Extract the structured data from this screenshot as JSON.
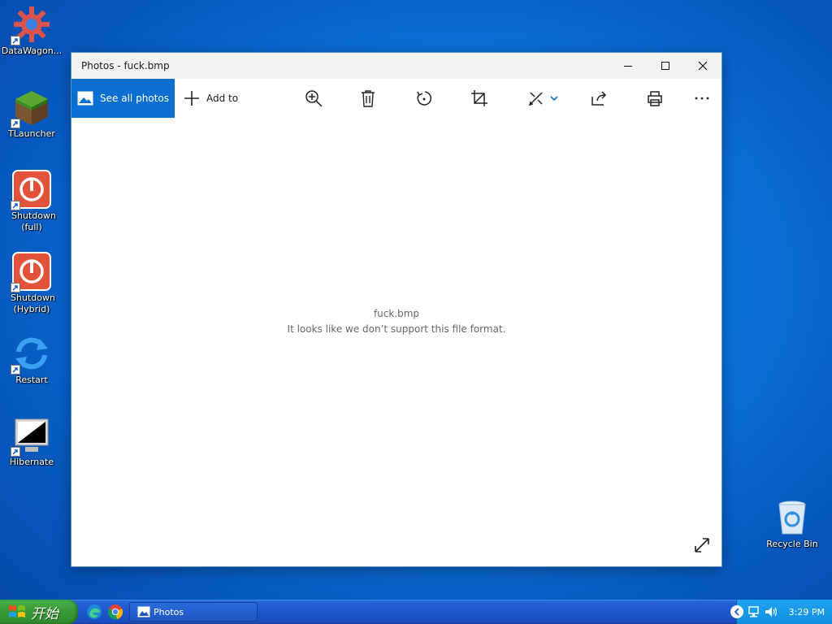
{
  "desktop": {
    "icons": [
      {
        "label": "DataWagon..."
      },
      {
        "label": "TLauncher"
      },
      {
        "label": "Shutdown (full)"
      },
      {
        "label": "Shutdown (Hybrid)"
      },
      {
        "label": "Restart"
      },
      {
        "label": "Hibernate"
      },
      {
        "label": "Recycle Bin"
      }
    ]
  },
  "window": {
    "title": "Photos - fuck.bmp",
    "toolbar": {
      "see_all_photos": "See all photos",
      "add_to": "Add to"
    },
    "message": {
      "filename": "fuck.bmp",
      "error": "It looks like we don’t support this file format."
    }
  },
  "taskbar": {
    "start_label": "开始",
    "task_label": "Photos",
    "clock": "3:29 PM"
  },
  "colors": {
    "accent": "#0a6fd1",
    "taskbar": "#1f56c9",
    "start_green": "#3a9b37"
  }
}
